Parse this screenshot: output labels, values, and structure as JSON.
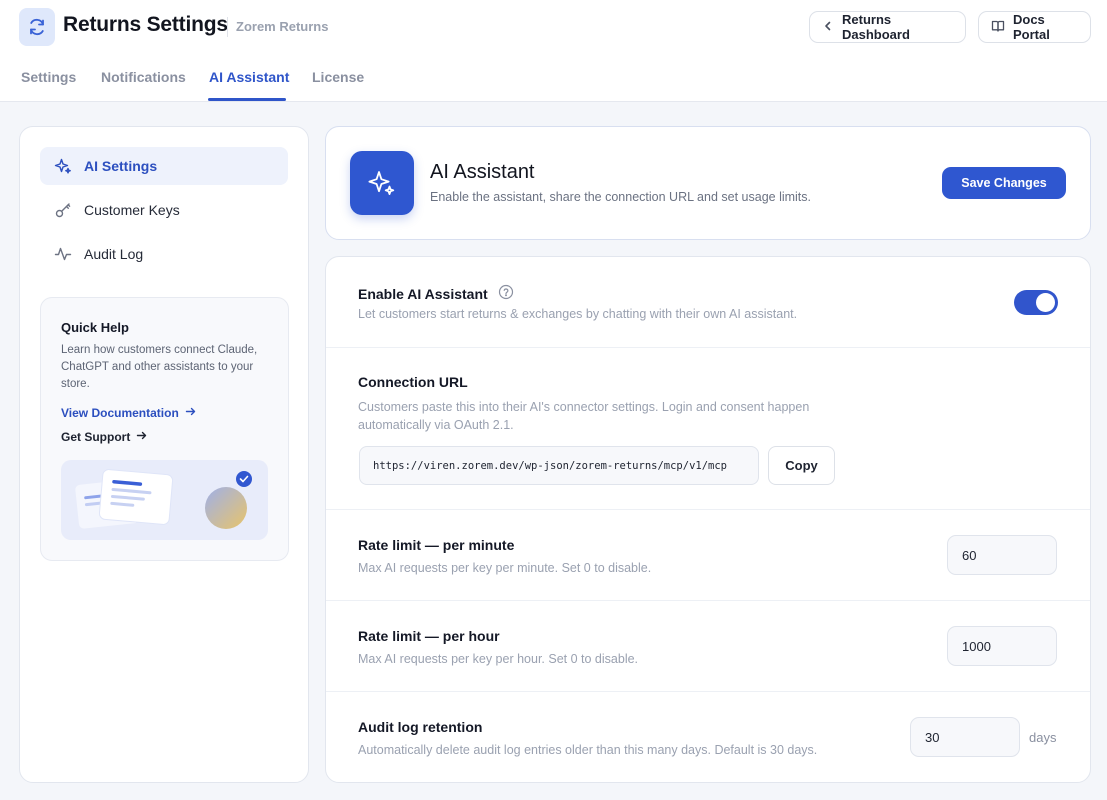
{
  "header": {
    "title": "Returns Settings",
    "subtitle": "Zorem Returns",
    "dashboard_btn": "Returns Dashboard",
    "docs_btn": "Docs Portal"
  },
  "tabs": [
    "Settings",
    "Notifications",
    "AI Assistant",
    "License"
  ],
  "active_tab": "AI Assistant",
  "sidebar": {
    "items": [
      {
        "label": "AI Settings",
        "icon": "sparkle-icon",
        "active": true
      },
      {
        "label": "Customer Keys",
        "icon": "key-icon",
        "active": false
      },
      {
        "label": "Audit Log",
        "icon": "activity-icon",
        "active": false
      }
    ],
    "help": {
      "title": "Quick Help",
      "text": "Learn how customers connect Claude, ChatGPT and other assistants to your store.",
      "doc_link": "View Documentation",
      "support_link": "Get Support"
    }
  },
  "assistant": {
    "title": "AI Assistant",
    "subtitle": "Enable the assistant, share the connection URL and set usage limits.",
    "save_label": "Save Changes"
  },
  "settings": {
    "enable": {
      "title": "Enable AI Assistant",
      "desc": "Let customers start returns & exchanges by chatting with their own AI assistant.",
      "enabled": true
    },
    "connection": {
      "title": "Connection URL",
      "desc": "Customers paste this into their AI's connector settings. Login and consent happen automatically via OAuth 2.1.",
      "url": "https://viren.zorem.dev/wp-json/zorem-returns/mcp/v1/mcp",
      "copy_label": "Copy"
    },
    "rate_minute": {
      "title": "Rate limit — per minute",
      "desc": "Max AI requests per key per minute. Set 0 to disable.",
      "value": "60"
    },
    "rate_hour": {
      "title": "Rate limit — per hour",
      "desc": "Max AI requests per key per hour. Set 0 to disable.",
      "value": "1000"
    },
    "retention": {
      "title": "Audit log retention",
      "desc": "Automatically delete audit log entries older than this many days. Default is 30 days.",
      "value": "30",
      "unit": "days"
    }
  },
  "colors": {
    "accent": "#2f57d0",
    "accent_light": "#eef2fc",
    "background": "#f4f6fa"
  }
}
